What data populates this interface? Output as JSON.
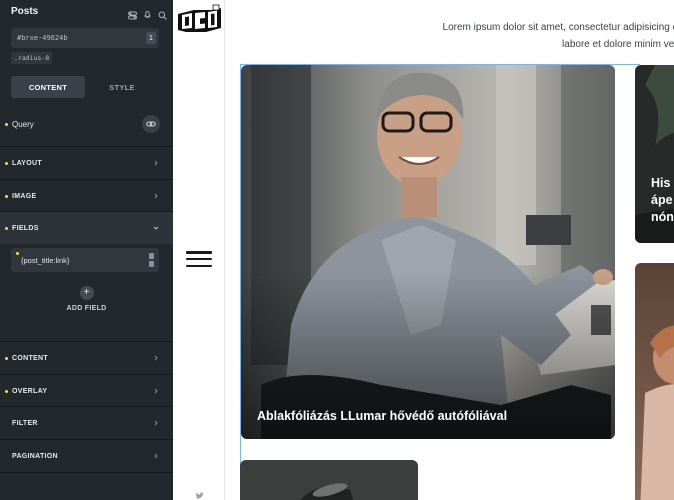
{
  "panel": {
    "title": "Posts",
    "element_id": "#brxe-49624b",
    "element_id_badge": "1",
    "class_chip": ".radius-8",
    "tabs": [
      {
        "label": "CONTENT",
        "active": true
      },
      {
        "label": "STYLE",
        "active": false
      }
    ],
    "query_label": "Query",
    "sections": {
      "layout": "LAYOUT",
      "image": "IMAGE",
      "fields": "FIELDS",
      "content": "CONTENT",
      "overlay": "OVERLAY",
      "filter": "FILTER",
      "pagination": "PAGINATION"
    },
    "field_value": "{post_title:link}",
    "add_field_label": "ADD FIELD"
  },
  "site": {
    "intro_lines": [
      "Lorem ipsum dolor sit amet, consectetur adipisicing elit, s",
      "labore et dolore minim veniam"
    ],
    "posts": [
      {
        "title": "Ablakfóliázás LLumar hővédő autófóliával"
      },
      {
        "title_lines": [
          "His v",
          "ápe",
          "nón"
        ]
      }
    ]
  },
  "colors": {
    "panel_bg": "#23282d",
    "accent_dot": "#ffd64f",
    "selection_outline": "#7ab7e8"
  },
  "icons": [
    "toggle-icon",
    "mic-icon",
    "search-icon",
    "link-icon",
    "chevron-right-icon",
    "chevron-down-icon",
    "plus-icon",
    "hamburger-icon",
    "twitter-icon",
    "logo"
  ]
}
